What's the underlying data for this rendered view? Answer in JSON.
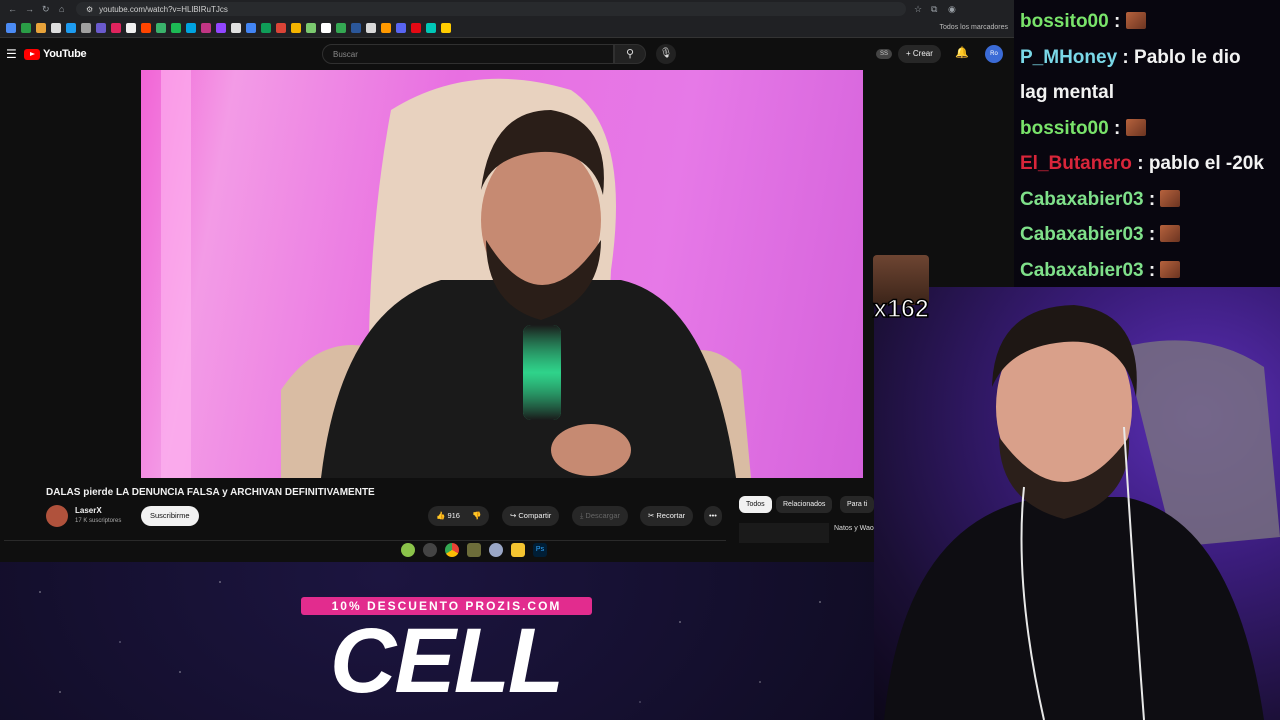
{
  "browser": {
    "url": "youtube.com/watch?v=HLlBIRuTJcs",
    "bookmarks_label": "Todos los marcadores"
  },
  "youtube": {
    "logo_text": "YouTube",
    "search_placeholder": "Buscar",
    "ss_badge": "SS",
    "create_label": "+ Crear",
    "avatar_text": "Ro"
  },
  "video": {
    "title": "DALAS pierde LA DENUNCIA FALSA y ARCHIVAN DEFINITIVAMENTE",
    "channel": "LaserX",
    "subscribers": "17 K suscriptores",
    "subscribe_label": "Suscribirme",
    "likes": "916",
    "share_label": "Compartir",
    "download_label": "Descargar",
    "clip_label": "Recortar",
    "more_label": "•••"
  },
  "related": {
    "chips": [
      "Todos",
      "Relacionados",
      "Para ti"
    ],
    "first_title": "Natos y Waor BAJO ZERO"
  },
  "chat": {
    "messages": [
      {
        "user": "bossito00",
        "text": "",
        "color": "#79e36a",
        "emote": true
      },
      {
        "user": "P_MHoney",
        "text": "Pablo le dio",
        "color": "#7ad8e8",
        "emote": false
      },
      {
        "user": "",
        "text": "lag mental",
        "color": "#f2f2f2",
        "emote": false
      },
      {
        "user": "bossito00",
        "text": "",
        "color": "#79e36a",
        "emote": true
      },
      {
        "user": "El_Butanero",
        "text": "pablo el -20k",
        "color": "#d8253a",
        "emote": false
      },
      {
        "user": "Cabaxabier03",
        "text": "",
        "color": "#7fe08a",
        "emote": true
      },
      {
        "user": "Cabaxabier03",
        "text": "",
        "color": "#7fe08a",
        "emote": true
      },
      {
        "user": "Cabaxabier03",
        "text": "",
        "color": "#7fe08a",
        "emote": true
      }
    ]
  },
  "overlay": {
    "sticker_count": "x162",
    "ad_badge": "10% DESCUENTO PROZIS.COM",
    "ad_big": "CELL"
  }
}
